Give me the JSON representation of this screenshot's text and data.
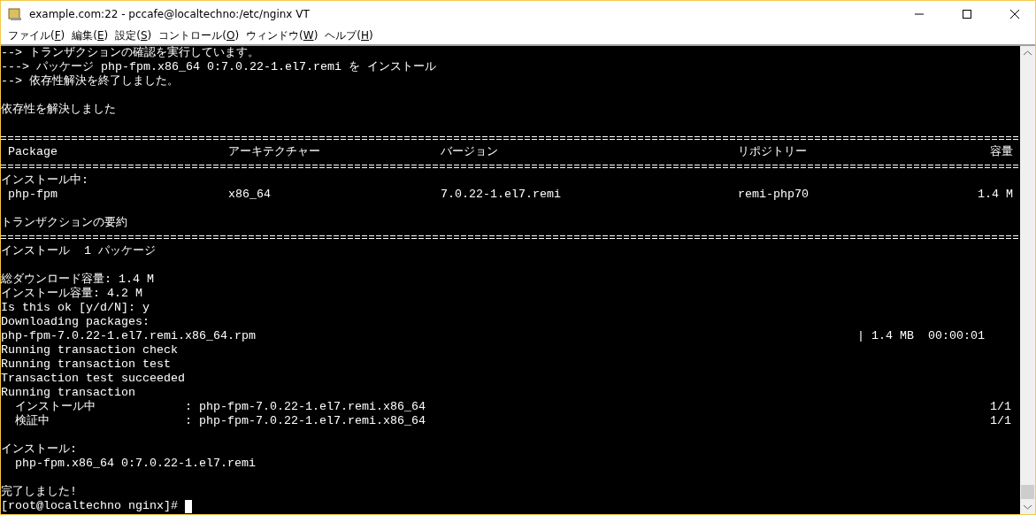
{
  "window": {
    "title": "example.com:22 - pccafe@localtechno:/etc/nginx VT"
  },
  "menu": [
    {
      "label": "ファイル(",
      "key": "F",
      "end": ")"
    },
    {
      "label": "編集(",
      "key": "E",
      "end": ")"
    },
    {
      "label": "設定(",
      "key": "S",
      "end": ")"
    },
    {
      "label": "コントロール(",
      "key": "O",
      "end": ")"
    },
    {
      "label": "ウィンドウ(",
      "key": "W",
      "end": ")"
    },
    {
      "label": "ヘルプ(",
      "key": "H",
      "end": ")"
    }
  ],
  "terminal": {
    "lines": [
      {
        "kind": "text",
        "text": "--> トランザクションの確認を実行しています。"
      },
      {
        "kind": "text",
        "text": "---> パッケージ php-fpm.x86_64 0:7.0.22-1.el7.remi を インストール"
      },
      {
        "kind": "text",
        "text": "--> 依存性解決を終了しました。"
      },
      {
        "kind": "blank"
      },
      {
        "kind": "text",
        "text": "依存性を解決しました"
      },
      {
        "kind": "blank"
      },
      {
        "kind": "rule"
      },
      {
        "kind": "row",
        "cells": [
          "Package",
          "アーキテクチャー",
          "バージョン",
          "リポジトリー",
          "容量"
        ]
      },
      {
        "kind": "rule"
      },
      {
        "kind": "text",
        "text": "インストール中:"
      },
      {
        "kind": "row",
        "cells": [
          "php-fpm",
          "x86_64",
          "7.0.22-1.el7.remi",
          "remi-php70",
          "1.4 M"
        ]
      },
      {
        "kind": "blank"
      },
      {
        "kind": "text",
        "text": "トランザクションの要約"
      },
      {
        "kind": "rule"
      },
      {
        "kind": "text",
        "text": "インストール  1 パッケージ"
      },
      {
        "kind": "blank"
      },
      {
        "kind": "text",
        "text": "総ダウンロード容量: 1.4 M"
      },
      {
        "kind": "text",
        "text": "インストール容量: 4.2 M"
      },
      {
        "kind": "text",
        "text": "Is this ok [y/d/N]: y"
      },
      {
        "kind": "text",
        "text": "Downloading packages:"
      },
      {
        "kind": "download",
        "text": "php-fpm-7.0.22-1.el7.remi.x86_64.rpm",
        "right": "| 1.4 MB  00:00:01"
      },
      {
        "kind": "text",
        "text": "Running transaction check"
      },
      {
        "kind": "text",
        "text": "Running transaction test"
      },
      {
        "kind": "text",
        "text": "Transaction test succeeded"
      },
      {
        "kind": "text",
        "text": "Running transaction"
      },
      {
        "kind": "step",
        "label": "インストール中",
        "value": ": php-fpm-7.0.22-1.el7.remi.x86_64",
        "right": "1/1"
      },
      {
        "kind": "step",
        "label": "検証中",
        "value": ": php-fpm-7.0.22-1.el7.remi.x86_64",
        "right": "1/1"
      },
      {
        "kind": "blank"
      },
      {
        "kind": "text",
        "text": "インストール:"
      },
      {
        "kind": "text",
        "text": "  php-fpm.x86_64 0:7.0.22-1.el7.remi"
      },
      {
        "kind": "blank"
      },
      {
        "kind": "text",
        "text": "完了しました!"
      },
      {
        "kind": "prompt",
        "text": "[root@localtechno nginx]#"
      }
    ]
  }
}
